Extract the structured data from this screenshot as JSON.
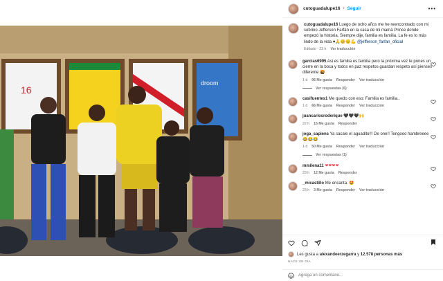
{
  "post_header": {
    "username": "cutoguadalupe16",
    "separator": "•",
    "follow_label": "Seguir",
    "more_label": "•••"
  },
  "caption": {
    "username": "cutoguadalupe16",
    "text": "Luego de ocho años me he reencontrado con mi sobrino Jefferson Farfán en la casa de mi mamá Prince donde empezó la historia. Siempre dije, familia es familia. La fe es lo más lindo de la vida ♥🙏😊😊💪",
    "mention": "@jefferson_farfan_oficial",
    "edited": "Editado",
    "separator": "·",
    "time": "23 h",
    "translation": "Ver traducción"
  },
  "comments": [
    {
      "username": "garcias6995",
      "text": "Asi es familia es familia pero la próxima vez te pones un cierre en la boca y todos en paz respetos guardan respeto así pienses diferente 🤬",
      "time": "1 d",
      "likes": "96 Me gusta",
      "reply": "Responder",
      "translate": "Ver traducción",
      "replies": "Ver respuestas (6)"
    },
    {
      "username": "casifuentes1",
      "text": "Me quedo con eso: Familia es familia..",
      "time": "1 d",
      "likes": "66 Me gusta",
      "reply": "Responder",
      "translate": "Ver traducción"
    },
    {
      "username": "juancarlosroderique",
      "text": "🖤🖤🖤🙌",
      "time": "22 h",
      "likes": "15 Me gusta",
      "reply": "Responder"
    },
    {
      "username": "joga_sapiens",
      "text": "Ya sacale el aguadito!!! De one!! Tengooo hambreeee😂😂😂",
      "time": "1 d",
      "likes": "50 Me gusta",
      "reply": "Responder",
      "translate": "Ver traducción",
      "replies": "Ver respuestas (1)"
    },
    {
      "username": "mmilena11",
      "text": "❤❤❤❤",
      "time": "23 h",
      "likes": "12 Me gusta",
      "reply": "Responder"
    },
    {
      "username": "_micastillo",
      "text": "Me encanta. 🤩",
      "time": "23 h",
      "likes": "3 Me gusta",
      "reply": "Responder",
      "translate": "Ver traducción"
    }
  ],
  "likes": {
    "prefix": "Les gusta a",
    "user": "alexandeerzegarra",
    "middle": "y",
    "count": "12.578 personas",
    "suffix": "más"
  },
  "time_ago": "HACE UN DÍA",
  "add_comment": {
    "placeholder": "Agrega un comentario..."
  },
  "colors": {
    "accent": "#0095f6",
    "link": "#00376b",
    "muted": "#737373",
    "wall": "#c9b58a"
  }
}
